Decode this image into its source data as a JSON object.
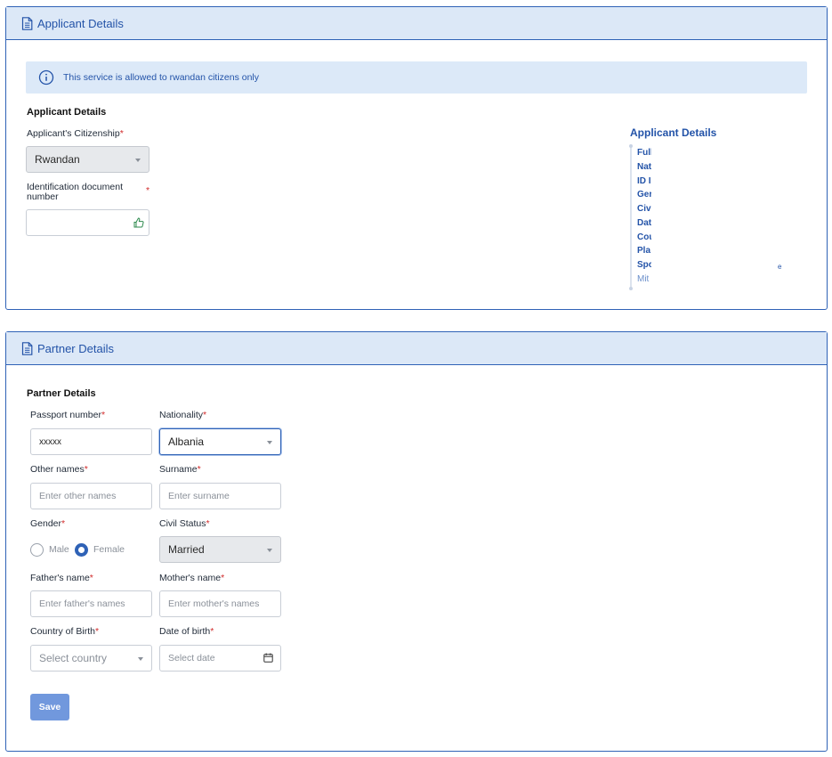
{
  "applicant_panel": {
    "header_title": "Applicant Details",
    "alert_text": "This service is allowed to rwandan citizens only",
    "section_title": "Applicant Details",
    "citizenship_label": "Applicant's Citizenship",
    "citizenship_value": "Rwandan",
    "id_doc_label_line1": "Identification document",
    "id_doc_label_line2": "number",
    "id_doc_value": "",
    "required_mark": "*"
  },
  "toc": {
    "title": "Applicant Details",
    "items": [
      "Full",
      "Nat",
      "ID I",
      "Ger",
      "Civ",
      "Dat",
      "Cou",
      "Pla",
      "Spo",
      "Mit"
    ],
    "stray_char": "e"
  },
  "partner_panel": {
    "header_title": "Partner Details",
    "section_title": "Partner Details",
    "passport_label": "Passport number",
    "passport_value": "xxxxx",
    "nationality_label": "Nationality",
    "nationality_value": "Albania",
    "other_names_label": "Other names",
    "other_names_placeholder": "Enter other names",
    "surname_label": "Surname",
    "surname_placeholder": "Enter surname",
    "gender_label": "Gender",
    "gender_options": [
      "Male",
      "Female"
    ],
    "gender_selected": "Female",
    "civil_status_label": "Civil Status",
    "civil_status_value": "Married",
    "father_label": "Father's name",
    "father_placeholder": "Enter father's names",
    "mother_label": "Mother's name",
    "mother_placeholder": "Enter mother's names",
    "country_birth_label": "Country of Birth",
    "country_birth_placeholder": "Select country",
    "dob_label": "Date of birth",
    "dob_placeholder": "Select date",
    "save_label": "Save"
  },
  "colors": {
    "primary": "#2f62b6",
    "header_bg": "#dce8f7",
    "required": "#d12b2b",
    "save_button": "#7198dd"
  },
  "icons": [
    "document-icon",
    "info-icon",
    "thumbs-up-icon",
    "calendar-icon",
    "chevron-down-icon"
  ]
}
